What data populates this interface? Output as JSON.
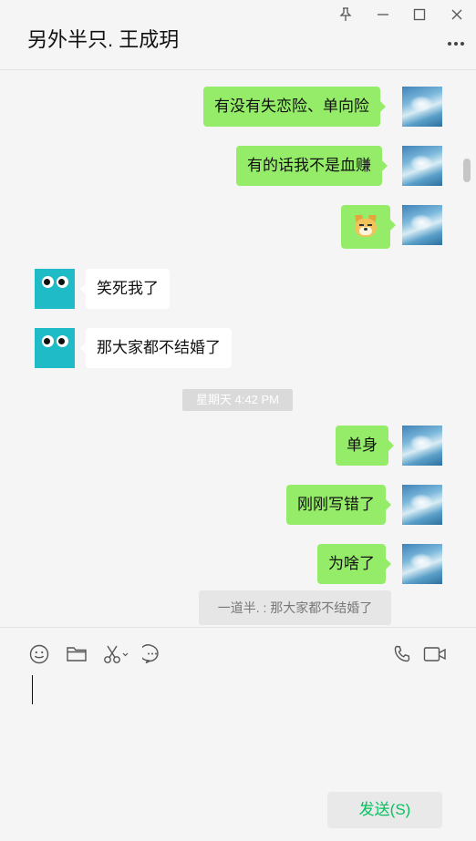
{
  "window": {
    "chat_title": "另外半只. 王成玥",
    "controls": [
      "pin-icon",
      "minimize-icon",
      "maximize-icon",
      "close-icon"
    ],
    "more_icon": "more-horizontal-icon"
  },
  "messages": [
    {
      "side": "out",
      "type": "text",
      "text": "有没有失恋险、单向险"
    },
    {
      "side": "out",
      "type": "text",
      "text": "有的话我不是血赚"
    },
    {
      "side": "out",
      "type": "emoji",
      "emoji": "doge-emoji"
    },
    {
      "side": "in",
      "type": "text",
      "text": "笑死我了"
    },
    {
      "side": "in",
      "type": "text",
      "text": "那大家都不结婚了"
    },
    {
      "side": "system",
      "type": "timestamp",
      "text": "星期天 4:42 PM"
    },
    {
      "side": "out",
      "type": "text",
      "text": "单身"
    },
    {
      "side": "out",
      "type": "text",
      "text": "刚刚写错了"
    },
    {
      "side": "out",
      "type": "text",
      "text": "为啥了"
    },
    {
      "side": "out",
      "type": "quote",
      "text": "一道半. : 那大家都不结婚了"
    }
  ],
  "toolbar": {
    "icons": [
      "emoji-icon",
      "folder-icon",
      "scissors-icon",
      "chat-history-icon",
      "phone-icon",
      "video-call-icon"
    ]
  },
  "input": {
    "value": ""
  },
  "send_button": {
    "label": "发送(S)"
  },
  "colors": {
    "outgoing_bubble": "#95ec69",
    "incoming_bubble": "#ffffff",
    "send_text": "#07c160",
    "background": "#f5f5f5"
  }
}
